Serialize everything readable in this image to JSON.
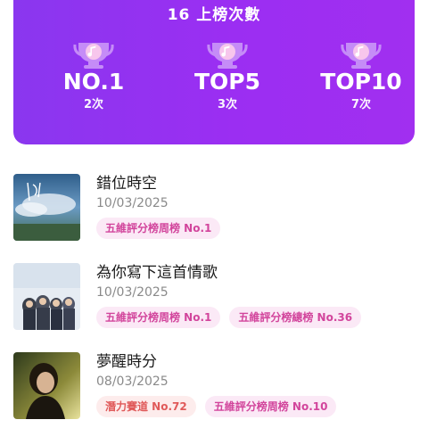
{
  "summary": {
    "chart_count_text": "16 上榜次數",
    "stats": [
      {
        "label": "NO.1",
        "count": "2次",
        "icon": "trophy-music-icon"
      },
      {
        "label": "TOP5",
        "count": "3次",
        "icon": "trophy-music-icon"
      },
      {
        "label": "TOP10",
        "count": "7次",
        "icon": "trophy-music-icon"
      }
    ],
    "card_color": "#9b2ef2"
  },
  "songs": [
    {
      "title": "錯位時空",
      "date": "10/03/2025",
      "tags": [
        {
          "text": "五維評分榜周榜 No.1",
          "style": "pink"
        }
      ]
    },
    {
      "title": "為你寫下這首情歌",
      "date": "10/03/2025",
      "tags": [
        {
          "text": "五維評分榜周榜 No.1",
          "style": "pink"
        },
        {
          "text": "五維評分榜總榜 No.36",
          "style": "pink"
        }
      ]
    },
    {
      "title": "夢醒時分",
      "date": "08/03/2025",
      "tags": [
        {
          "text": "潛力賽道 No.72",
          "style": "red"
        },
        {
          "text": "五維評分榜周榜 No.10",
          "style": "pink"
        }
      ]
    }
  ]
}
